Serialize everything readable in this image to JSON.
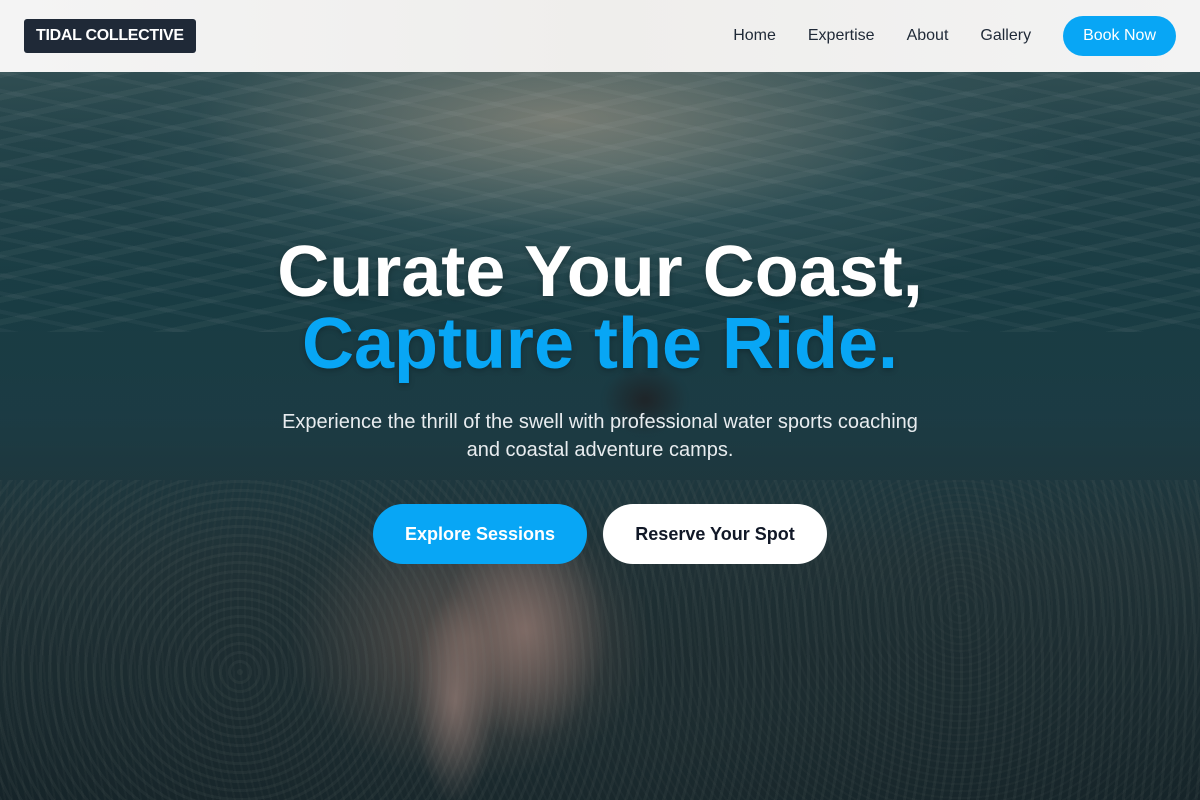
{
  "nav": {
    "brand": "TIDAL COLLECTIVE",
    "links": [
      "Home",
      "Expertise",
      "About",
      "Gallery"
    ],
    "cta": "Book Now"
  },
  "hero": {
    "headline_line1": "Curate Your Coast,",
    "headline_line2": "Capture the Ride.",
    "subheadline": "Experience the thrill of the swell with professional water sports coaching and coastal adventure camps.",
    "primary_cta": "Explore Sessions",
    "secondary_cta": "Reserve Your Spot"
  },
  "colors": {
    "accent": "#08a6f5",
    "brand_bg": "#1f2937",
    "nav_bg": "#f4f4f4"
  }
}
